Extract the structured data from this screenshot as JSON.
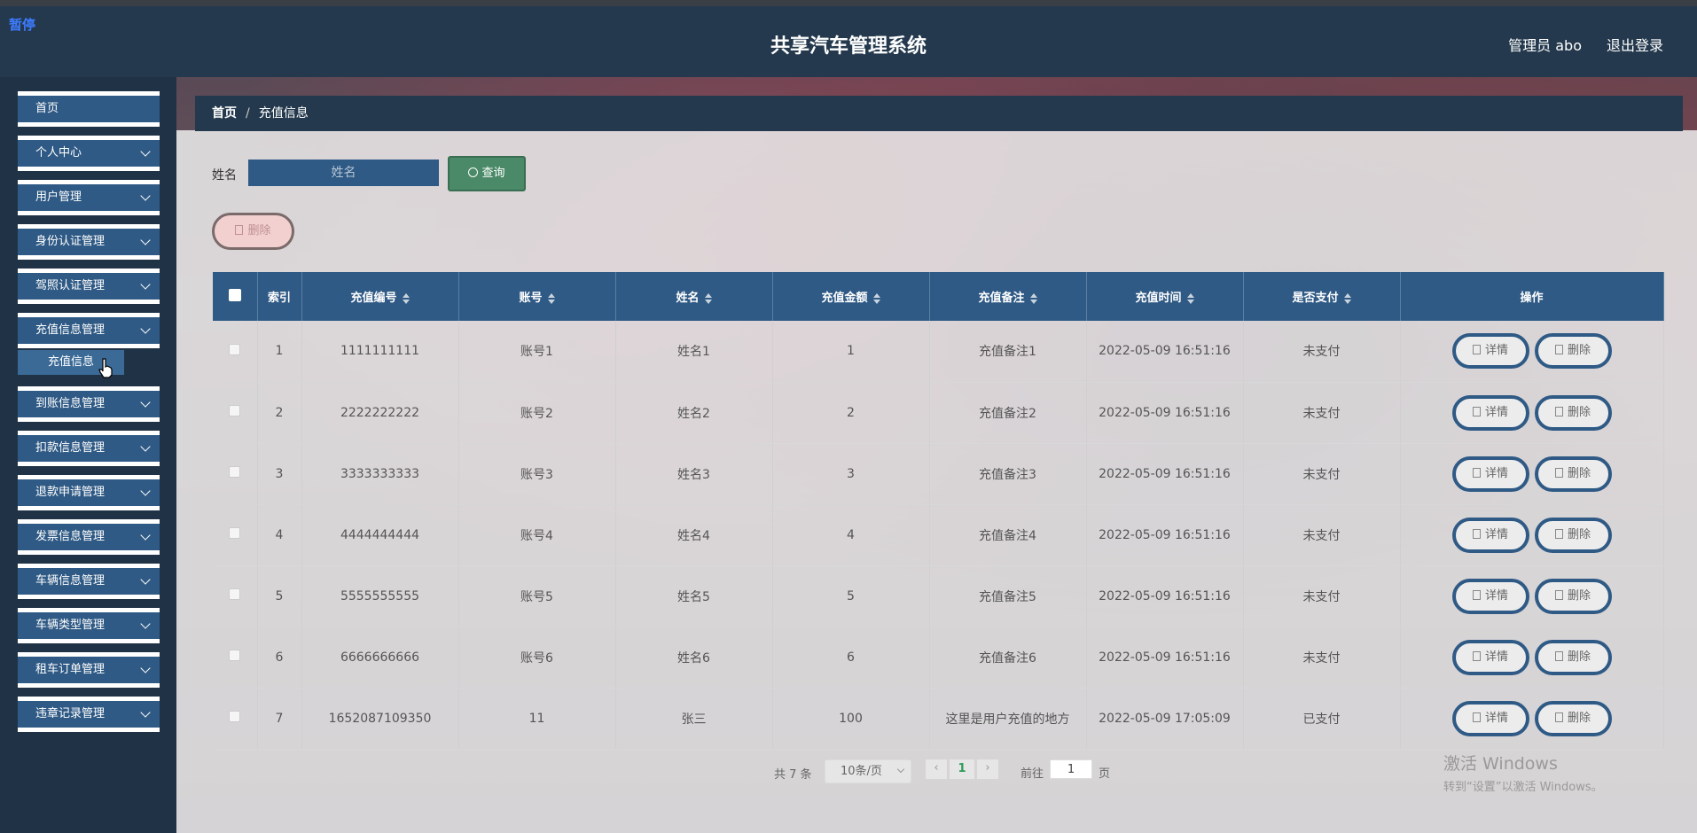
{
  "header": {
    "pause_tag": "暂停",
    "title": "共享汽车管理系统",
    "user": "管理员 abo",
    "logout": "退出登录"
  },
  "sidebar": {
    "items": [
      {
        "label": "首页",
        "has_chevron": false
      },
      {
        "label": "个人中心",
        "has_chevron": true
      },
      {
        "label": "用户管理",
        "has_chevron": true
      },
      {
        "label": "身份认证管理",
        "has_chevron": true
      },
      {
        "label": "驾照认证管理",
        "has_chevron": true
      },
      {
        "label": "充值信息管理",
        "has_chevron": true
      },
      {
        "label": "到账信息管理",
        "has_chevron": true
      },
      {
        "label": "扣款信息管理",
        "has_chevron": true
      },
      {
        "label": "退款申请管理",
        "has_chevron": true
      },
      {
        "label": "发票信息管理",
        "has_chevron": true
      },
      {
        "label": "车辆信息管理",
        "has_chevron": true
      },
      {
        "label": "车辆类型管理",
        "has_chevron": true
      },
      {
        "label": "租车订单管理",
        "has_chevron": true
      },
      {
        "label": "违章记录管理",
        "has_chevron": true
      }
    ],
    "submenu_active": "充值信息"
  },
  "breadcrumb": {
    "home": "首页",
    "sep": "/",
    "current": "充值信息"
  },
  "search": {
    "label": "姓名",
    "placeholder": "姓名",
    "query_button": "查询"
  },
  "actions": {
    "batch_delete": "删除"
  },
  "table": {
    "columns": [
      "索引",
      "充值编号",
      "账号",
      "姓名",
      "充值金额",
      "充值备注",
      "充值时间",
      "是否支付",
      "操作"
    ],
    "rows": [
      {
        "index": "1",
        "recharge_no": "1111111111",
        "account": "账号1",
        "name": "姓名1",
        "amount": "1",
        "remark": "充值备注1",
        "time": "2022-05-09 16:51:16",
        "paid": "未支付"
      },
      {
        "index": "2",
        "recharge_no": "2222222222",
        "account": "账号2",
        "name": "姓名2",
        "amount": "2",
        "remark": "充值备注2",
        "time": "2022-05-09 16:51:16",
        "paid": "未支付"
      },
      {
        "index": "3",
        "recharge_no": "3333333333",
        "account": "账号3",
        "name": "姓名3",
        "amount": "3",
        "remark": "充值备注3",
        "time": "2022-05-09 16:51:16",
        "paid": "未支付"
      },
      {
        "index": "4",
        "recharge_no": "4444444444",
        "account": "账号4",
        "name": "姓名4",
        "amount": "4",
        "remark": "充值备注4",
        "time": "2022-05-09 16:51:16",
        "paid": "未支付"
      },
      {
        "index": "5",
        "recharge_no": "5555555555",
        "account": "账号5",
        "name": "姓名5",
        "amount": "5",
        "remark": "充值备注5",
        "time": "2022-05-09 16:51:16",
        "paid": "未支付"
      },
      {
        "index": "6",
        "recharge_no": "6666666666",
        "account": "账号6",
        "name": "姓名6",
        "amount": "6",
        "remark": "充值备注6",
        "time": "2022-05-09 16:51:16",
        "paid": "未支付"
      },
      {
        "index": "7",
        "recharge_no": "1652087109350",
        "account": "11",
        "name": "张三",
        "amount": "100",
        "remark": "这里是用户充值的地方",
        "time": "2022-05-09 17:05:09",
        "paid": "已支付"
      }
    ],
    "detail_label": "详情",
    "delete_label": "删除"
  },
  "pager": {
    "total": "共 7 条",
    "page_size": "10条/页",
    "prev": "‹",
    "current_page": "1",
    "next": "›",
    "goto_label": "前往",
    "goto_value": "1",
    "page_unit": "页"
  },
  "watermark": {
    "line1": "激活 Windows",
    "line2": "转到“设置”以激活 Windows。"
  },
  "colors": {
    "header_bg": "#24394d",
    "menu_bar": "#2f5a85",
    "query_button": "#4a8a68",
    "delete_pill": "#f2d0d0",
    "paid_current_page": "#2e9c5a"
  },
  "icons": {
    "query": "search-icon",
    "delete": "trash-icon",
    "detail": "document-icon",
    "menu": "chevron-down-icon",
    "sort": "sort-icon"
  }
}
